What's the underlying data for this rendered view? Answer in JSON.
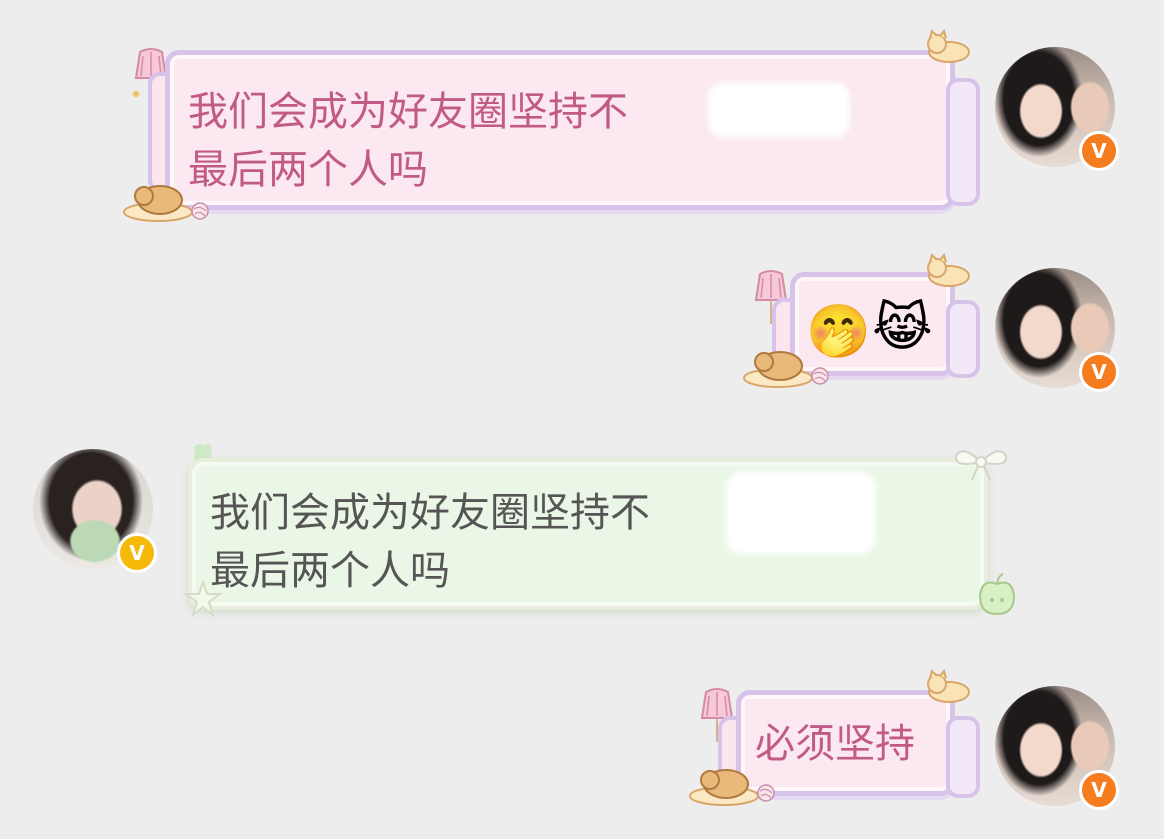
{
  "colors": {
    "background": "#ededed",
    "pink_bubble_text": "#c25a86",
    "pink_bubble_fill": "#fbe8f1",
    "pink_bubble_border": "#d7c3e9",
    "green_bubble_text": "#555555",
    "green_bubble_fill": "#eaf7e6",
    "badge_orange": "#f57c1f",
    "badge_yellow": "#f5b90a"
  },
  "messages": [
    {
      "sender": "me",
      "style": "pink",
      "text": "我们会成为好友圈坚持不            的\n最后两个人吗",
      "blurred_segment": true
    },
    {
      "sender": "me",
      "style": "pink",
      "emojis": [
        "🤭",
        "😹"
      ],
      "emoji_icons": [
        "hand-over-mouth-emoji-icon",
        "cat-tears-of-joy-emoji-icon"
      ]
    },
    {
      "sender": "friend",
      "style": "green",
      "text": "我们会成为好友圈坚持不            的\n最后两个人吗",
      "blurred_segment": true
    },
    {
      "sender": "me",
      "style": "pink",
      "text": "必须坚持"
    }
  ],
  "avatars": {
    "me": {
      "badge": "V",
      "badge_color": "#f57c1f"
    },
    "friend": {
      "badge": "V",
      "badge_color": "#f5b90a"
    }
  },
  "decorations": {
    "lamp_icon": "lamp-icon",
    "cat_icon": "sleeping-cat-icon",
    "yarn_icon": "yarn-ball-icon",
    "clover_icon": "clover-icon",
    "apple_icon": "apple-icon",
    "bow_icon": "bow-icon"
  }
}
